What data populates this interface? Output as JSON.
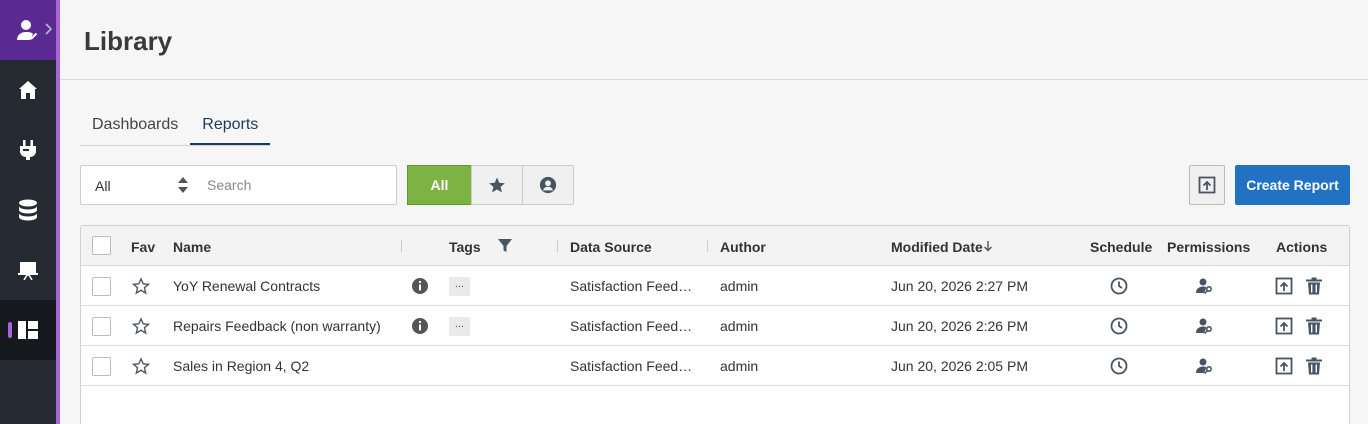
{
  "sidebar": {
    "items": [
      {
        "name": "home",
        "icon": "home-icon"
      },
      {
        "name": "connections",
        "icon": "plug-icon"
      },
      {
        "name": "data",
        "icon": "database-icon"
      },
      {
        "name": "presentations",
        "icon": "presentation-icon"
      },
      {
        "name": "library",
        "icon": "dashboard-icon",
        "active": true
      }
    ]
  },
  "header": {
    "title": "Library"
  },
  "tabs": [
    {
      "label": "Dashboards",
      "active": false
    },
    {
      "label": "Reports",
      "active": true
    }
  ],
  "filter": {
    "select_value": "All",
    "search_placeholder": "Search",
    "segments": {
      "all_label": "All"
    }
  },
  "toolbar": {
    "create_label": "Create Report"
  },
  "table": {
    "columns": {
      "fav": "Fav",
      "name": "Name",
      "tags": "Tags",
      "data_source": "Data Source",
      "author": "Author",
      "modified": "Modified Date",
      "schedule": "Schedule",
      "permissions": "Permissions",
      "actions": "Actions"
    },
    "rows": [
      {
        "name": "YoY Renewal Contracts",
        "has_info": true,
        "tags": "...",
        "data_source": "Satisfaction Feedback",
        "author": "admin",
        "modified": "Jun 20, 2026 2:27 PM"
      },
      {
        "name": "Repairs Feedback (non warranty)",
        "has_info": true,
        "tags": "...",
        "data_source": "Satisfaction Feedback",
        "author": "admin",
        "modified": "Jun 20, 2026 2:26 PM"
      },
      {
        "name": "Sales in Region 4, Q2",
        "has_info": false,
        "tags": "",
        "data_source": "Satisfaction Feedback",
        "author": "admin",
        "modified": "Jun 20, 2026 2:05 PM"
      }
    ]
  },
  "colors": {
    "accent": "#a864d8",
    "primary": "#2172c3",
    "all_active": "#7cb342",
    "sidebar": "#262b33"
  }
}
